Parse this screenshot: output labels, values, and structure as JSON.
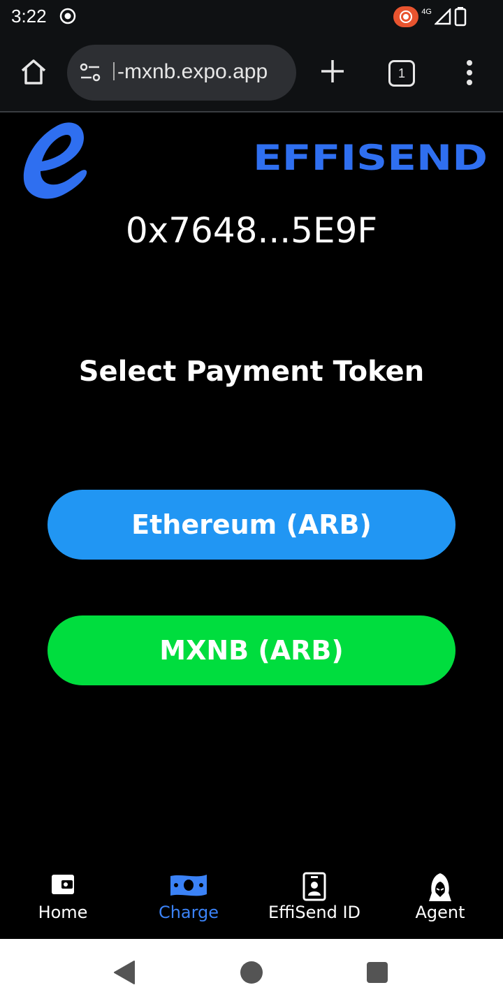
{
  "status_bar": {
    "time": "3:22",
    "network": "4G"
  },
  "browser": {
    "url": "-mxnb.expo.app",
    "tab_count": "1"
  },
  "app": {
    "brand_name": "EFFISEND",
    "wallet_address": "0x7648...5E9F",
    "heading": "Select Payment Token",
    "tokens": [
      {
        "label": "Ethereum (ARB)",
        "color": "#2196F3"
      },
      {
        "label": "MXNB (ARB)",
        "color": "#00DD3E"
      }
    ],
    "brand_color": "#2F6FF0"
  },
  "tabbar": {
    "active_tab": "Charge",
    "active_color": "#3B82F6",
    "items": [
      {
        "label": "Home",
        "icon": "wallet-icon"
      },
      {
        "label": "Charge",
        "icon": "banknote-icon"
      },
      {
        "label": "EffiSend ID",
        "icon": "id-badge-icon"
      },
      {
        "label": "Agent",
        "icon": "hooded-agent-icon"
      }
    ]
  }
}
